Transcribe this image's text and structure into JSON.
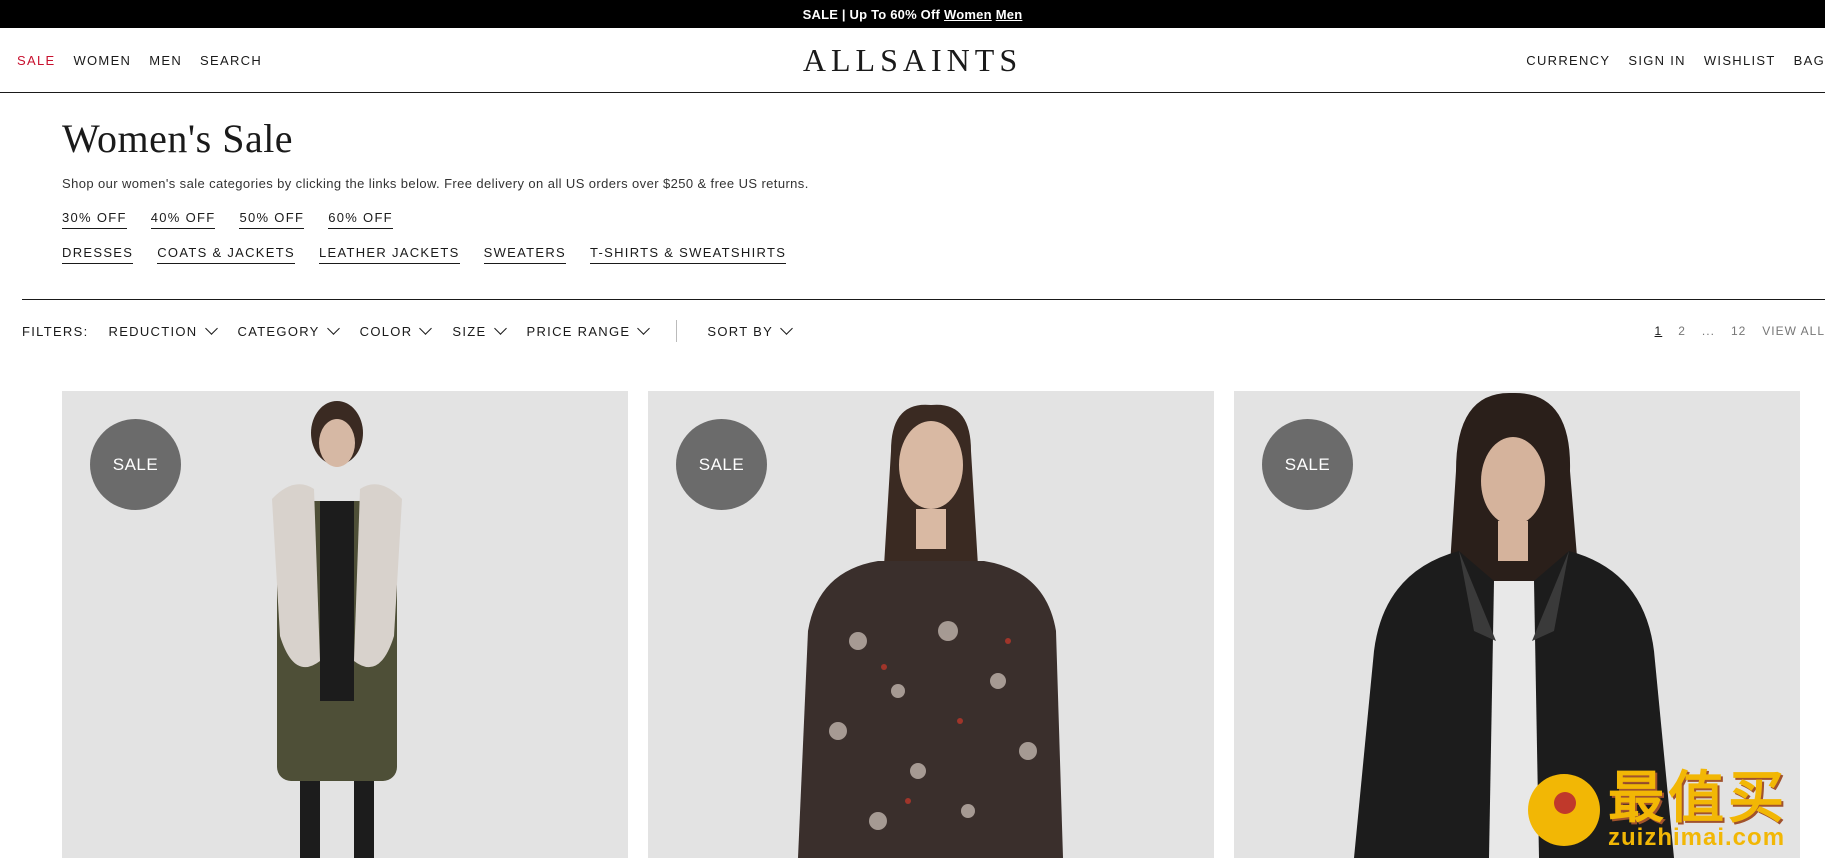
{
  "promo": {
    "text": "SALE | Up To 60% Off",
    "link1": "Women",
    "link2": "Men"
  },
  "header": {
    "logo": "ALLSAINTS",
    "nav_left": [
      "SALE",
      "WOMEN",
      "MEN",
      "SEARCH"
    ],
    "nav_right": [
      "CURRENCY",
      "SIGN IN",
      "WISHLIST",
      "BAG"
    ]
  },
  "intro": {
    "title": "Women's Sale",
    "description": "Shop our women's sale categories by clicking the links below. Free delivery on all US orders over $250 & free US returns.",
    "discount_links": [
      "30% OFF",
      "40% OFF",
      "50% OFF",
      "60% OFF"
    ],
    "category_links": [
      "DRESSES",
      "COATS & JACKETS",
      "LEATHER JACKETS",
      "SWEATERS",
      "T-SHIRTS & SWEATSHIRTS"
    ]
  },
  "filters": {
    "label": "FILTERS:",
    "options": [
      "REDUCTION",
      "CATEGORY",
      "COLOR",
      "SIZE",
      "PRICE RANGE"
    ],
    "sort_label": "SORT BY"
  },
  "pagination": {
    "pages": [
      "1",
      "2",
      "...",
      "12"
    ],
    "current": "1",
    "view_all": "VIEW ALL"
  },
  "products": [
    {
      "badge": "SALE",
      "garment_color": "#4e4f37",
      "accent": "#d8d2cc"
    },
    {
      "badge": "SALE",
      "garment_color": "#3a2f2c",
      "accent": "#b9ada6"
    },
    {
      "badge": "SALE",
      "garment_color": "#1c1c1c",
      "accent": "#e8e8e8"
    }
  ],
  "watermark": {
    "cn": "最值买",
    "en": "zuizhimai.com"
  }
}
